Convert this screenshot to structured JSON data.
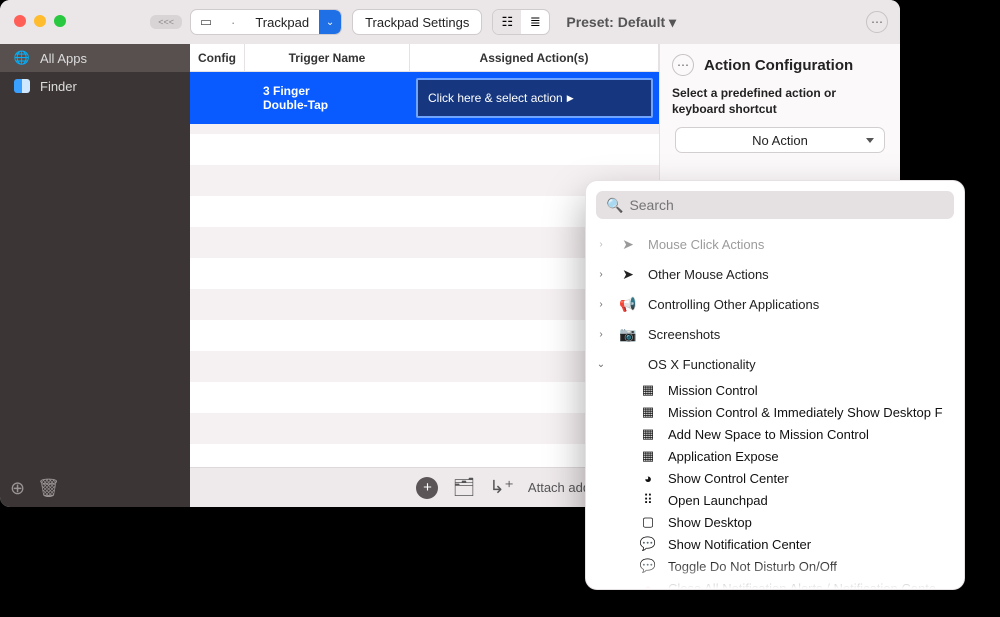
{
  "toolbar": {
    "device_label": "Trackpad",
    "settings_label": "Trackpad Settings",
    "preset_label": "Preset: Default ▾"
  },
  "sidebar": {
    "items": [
      {
        "label": "All Apps"
      },
      {
        "label": "Finder"
      }
    ]
  },
  "columns": {
    "config": "Config",
    "trigger": "Trigger Name",
    "action": "Assigned Action(s)"
  },
  "trigger_row": {
    "name": "3 Finger\nDouble-Tap",
    "action_prompt": "Click here & select action"
  },
  "footer": {
    "attach_label": "Attach additional act"
  },
  "right_panel": {
    "title": "Action Configuration",
    "subtitle": "Select a predefined action or keyboard shortcut",
    "dropdown": "No Action"
  },
  "popover": {
    "search_placeholder": "Search",
    "categories": [
      {
        "label": "Mouse Click Actions",
        "icon": "➤",
        "expanded": false,
        "faded": true
      },
      {
        "label": "Other Mouse Actions",
        "icon": "➤",
        "expanded": false
      },
      {
        "label": "Controlling Other Applications",
        "icon": "📢",
        "expanded": false
      },
      {
        "label": "Screenshots",
        "icon": "📷",
        "expanded": false
      },
      {
        "label": "OS X Functionality",
        "icon": "",
        "expanded": true
      }
    ],
    "osx_items": [
      {
        "label": "Mission Control",
        "icon": "grid"
      },
      {
        "label": "Mission Control & Immediately Show Desktop F",
        "icon": "grid"
      },
      {
        "label": "Add New Space to Mission Control",
        "icon": "grid"
      },
      {
        "label": "Application Expose",
        "icon": "grid"
      },
      {
        "label": "Show Control Center",
        "icon": "gauge"
      },
      {
        "label": "Open Launchpad",
        "icon": "dots"
      },
      {
        "label": "Show Desktop",
        "icon": "rect"
      },
      {
        "label": "Show Notification Center",
        "icon": "chat"
      },
      {
        "label": "Toggle Do Not Disturb On/Off",
        "icon": "chat"
      },
      {
        "label": "Close All Notification Alerts / Notification Cente",
        "icon": "reddot"
      }
    ]
  }
}
